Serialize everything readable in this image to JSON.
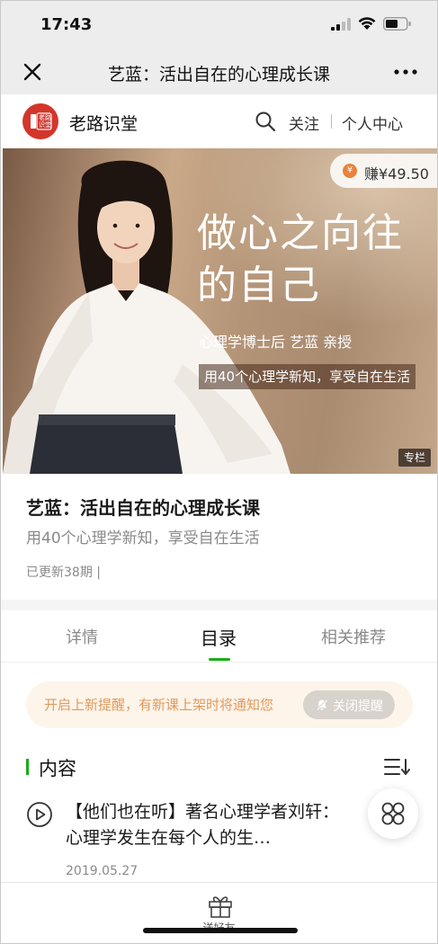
{
  "status_bar": {
    "time": "17:43"
  },
  "nav": {
    "title": "艺蓝：活出自在的心理成长课"
  },
  "brand": {
    "logo_text": "老路识堂",
    "name": "老路识堂",
    "follow_label": "关注",
    "user_center_label": "个人中心"
  },
  "banner": {
    "earn_label": "赚¥49.50",
    "headline_line1": "做心之向往",
    "headline_line2": "的自己",
    "author_line": "心理学博士后  艺蓝  亲授",
    "tagline": "用40个心理学新知，享受自在生活",
    "badge": "专栏"
  },
  "course": {
    "title": "艺蓝：活出自在的心理成长课",
    "subtitle": "用40个心理学新知，享受自在生活",
    "updated": "已更新38期 |"
  },
  "tabs": [
    {
      "label": "详情",
      "active": false
    },
    {
      "label": "目录",
      "active": true
    },
    {
      "label": "相关推荐",
      "active": false
    }
  ],
  "notice": {
    "text": "开启上新提醒，有新课上架时将通知您",
    "button_label": "关闭提醒"
  },
  "content": {
    "heading": "内容",
    "items": [
      {
        "title": "【他们也在听】著名心理学者刘轩：心理学发生在每个人的生…",
        "date": "2019.05.27"
      }
    ]
  },
  "bottom_bar": {
    "gift_label": "送好友"
  },
  "colors": {
    "accent_green": "#1aad19",
    "brand_red": "#d4352b",
    "notice_bg": "#fdf4ea",
    "notice_text": "#e2995a",
    "coin_orange": "#e8823b"
  }
}
